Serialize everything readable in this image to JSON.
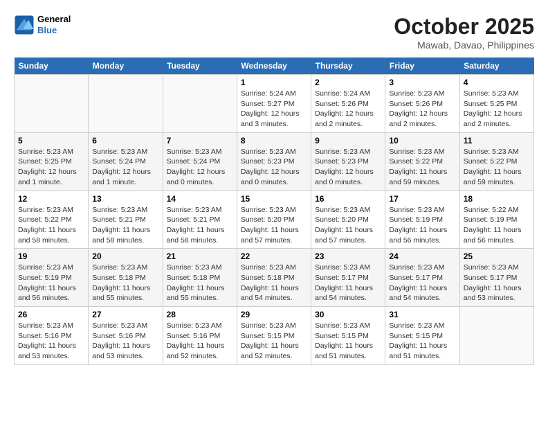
{
  "header": {
    "logo_line1": "General",
    "logo_line2": "Blue",
    "title": "October 2025",
    "subtitle": "Mawab, Davao, Philippines"
  },
  "days_of_week": [
    "Sunday",
    "Monday",
    "Tuesday",
    "Wednesday",
    "Thursday",
    "Friday",
    "Saturday"
  ],
  "weeks": [
    [
      {
        "day": null,
        "info": null
      },
      {
        "day": null,
        "info": null
      },
      {
        "day": null,
        "info": null
      },
      {
        "day": "1",
        "info": "Sunrise: 5:24 AM\nSunset: 5:27 PM\nDaylight: 12 hours and 3 minutes."
      },
      {
        "day": "2",
        "info": "Sunrise: 5:24 AM\nSunset: 5:26 PM\nDaylight: 12 hours and 2 minutes."
      },
      {
        "day": "3",
        "info": "Sunrise: 5:23 AM\nSunset: 5:26 PM\nDaylight: 12 hours and 2 minutes."
      },
      {
        "day": "4",
        "info": "Sunrise: 5:23 AM\nSunset: 5:25 PM\nDaylight: 12 hours and 2 minutes."
      }
    ],
    [
      {
        "day": "5",
        "info": "Sunrise: 5:23 AM\nSunset: 5:25 PM\nDaylight: 12 hours and 1 minute."
      },
      {
        "day": "6",
        "info": "Sunrise: 5:23 AM\nSunset: 5:24 PM\nDaylight: 12 hours and 1 minute."
      },
      {
        "day": "7",
        "info": "Sunrise: 5:23 AM\nSunset: 5:24 PM\nDaylight: 12 hours and 0 minutes."
      },
      {
        "day": "8",
        "info": "Sunrise: 5:23 AM\nSunset: 5:23 PM\nDaylight: 12 hours and 0 minutes."
      },
      {
        "day": "9",
        "info": "Sunrise: 5:23 AM\nSunset: 5:23 PM\nDaylight: 12 hours and 0 minutes."
      },
      {
        "day": "10",
        "info": "Sunrise: 5:23 AM\nSunset: 5:22 PM\nDaylight: 11 hours and 59 minutes."
      },
      {
        "day": "11",
        "info": "Sunrise: 5:23 AM\nSunset: 5:22 PM\nDaylight: 11 hours and 59 minutes."
      }
    ],
    [
      {
        "day": "12",
        "info": "Sunrise: 5:23 AM\nSunset: 5:22 PM\nDaylight: 11 hours and 58 minutes."
      },
      {
        "day": "13",
        "info": "Sunrise: 5:23 AM\nSunset: 5:21 PM\nDaylight: 11 hours and 58 minutes."
      },
      {
        "day": "14",
        "info": "Sunrise: 5:23 AM\nSunset: 5:21 PM\nDaylight: 11 hours and 58 minutes."
      },
      {
        "day": "15",
        "info": "Sunrise: 5:23 AM\nSunset: 5:20 PM\nDaylight: 11 hours and 57 minutes."
      },
      {
        "day": "16",
        "info": "Sunrise: 5:23 AM\nSunset: 5:20 PM\nDaylight: 11 hours and 57 minutes."
      },
      {
        "day": "17",
        "info": "Sunrise: 5:23 AM\nSunset: 5:19 PM\nDaylight: 11 hours and 56 minutes."
      },
      {
        "day": "18",
        "info": "Sunrise: 5:22 AM\nSunset: 5:19 PM\nDaylight: 11 hours and 56 minutes."
      }
    ],
    [
      {
        "day": "19",
        "info": "Sunrise: 5:23 AM\nSunset: 5:19 PM\nDaylight: 11 hours and 56 minutes."
      },
      {
        "day": "20",
        "info": "Sunrise: 5:23 AM\nSunset: 5:18 PM\nDaylight: 11 hours and 55 minutes."
      },
      {
        "day": "21",
        "info": "Sunrise: 5:23 AM\nSunset: 5:18 PM\nDaylight: 11 hours and 55 minutes."
      },
      {
        "day": "22",
        "info": "Sunrise: 5:23 AM\nSunset: 5:18 PM\nDaylight: 11 hours and 54 minutes."
      },
      {
        "day": "23",
        "info": "Sunrise: 5:23 AM\nSunset: 5:17 PM\nDaylight: 11 hours and 54 minutes."
      },
      {
        "day": "24",
        "info": "Sunrise: 5:23 AM\nSunset: 5:17 PM\nDaylight: 11 hours and 54 minutes."
      },
      {
        "day": "25",
        "info": "Sunrise: 5:23 AM\nSunset: 5:17 PM\nDaylight: 11 hours and 53 minutes."
      }
    ],
    [
      {
        "day": "26",
        "info": "Sunrise: 5:23 AM\nSunset: 5:16 PM\nDaylight: 11 hours and 53 minutes."
      },
      {
        "day": "27",
        "info": "Sunrise: 5:23 AM\nSunset: 5:16 PM\nDaylight: 11 hours and 53 minutes."
      },
      {
        "day": "28",
        "info": "Sunrise: 5:23 AM\nSunset: 5:16 PM\nDaylight: 11 hours and 52 minutes."
      },
      {
        "day": "29",
        "info": "Sunrise: 5:23 AM\nSunset: 5:15 PM\nDaylight: 11 hours and 52 minutes."
      },
      {
        "day": "30",
        "info": "Sunrise: 5:23 AM\nSunset: 5:15 PM\nDaylight: 11 hours and 51 minutes."
      },
      {
        "day": "31",
        "info": "Sunrise: 5:23 AM\nSunset: 5:15 PM\nDaylight: 11 hours and 51 minutes."
      },
      {
        "day": null,
        "info": null
      }
    ]
  ]
}
